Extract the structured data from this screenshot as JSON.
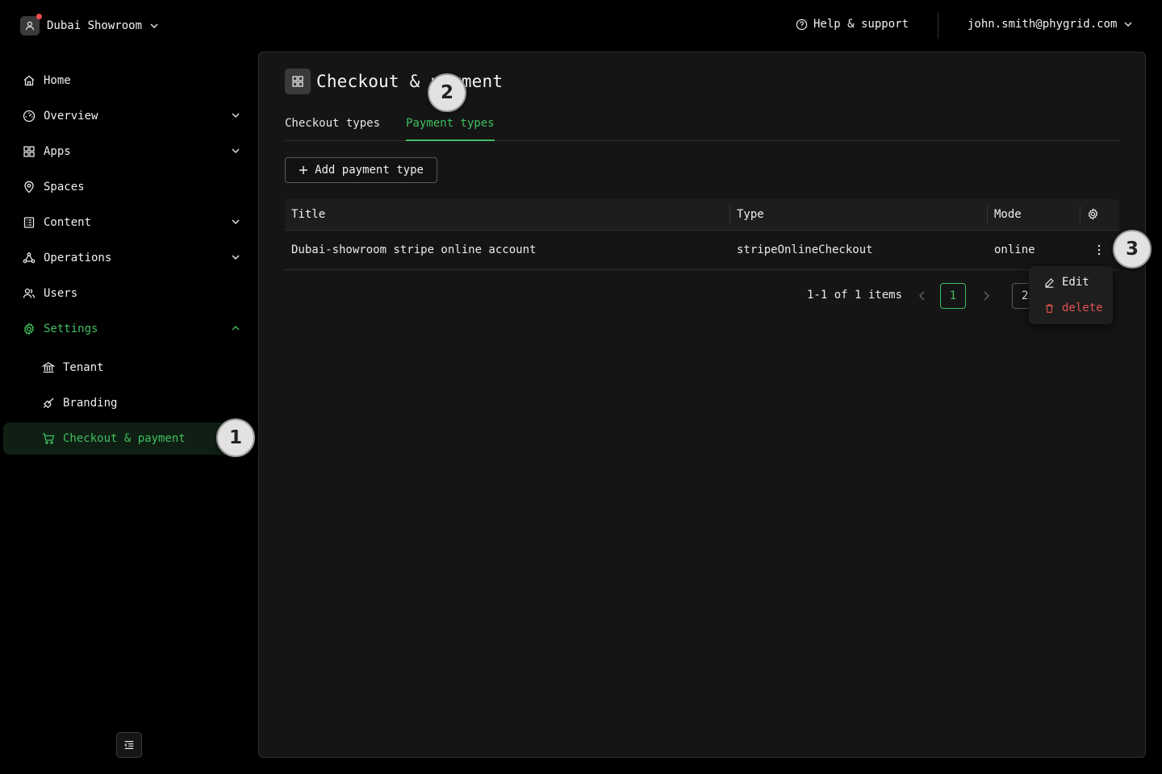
{
  "header": {
    "tenant": "Dubai Showroom",
    "help_label": "Help & support",
    "user_email": "john.smith@phygrid.com"
  },
  "sidebar": {
    "items": [
      {
        "label": "Home",
        "icon": "home-icon"
      },
      {
        "label": "Overview",
        "icon": "dashboard-icon"
      },
      {
        "label": "Apps",
        "icon": "apps-grid-icon"
      },
      {
        "label": "Spaces",
        "icon": "location-pin-icon"
      },
      {
        "label": "Content",
        "icon": "content-list-icon"
      },
      {
        "label": "Operations",
        "icon": "network-icon"
      },
      {
        "label": "Users",
        "icon": "users-icon"
      },
      {
        "label": "Settings",
        "icon": "gear-icon"
      }
    ],
    "settings_sub": [
      {
        "label": "Tenant",
        "icon": "bank-icon"
      },
      {
        "label": "Branding",
        "icon": "brush-icon"
      },
      {
        "label": "Checkout & payment",
        "icon": "cart-icon"
      }
    ]
  },
  "page": {
    "title": "Checkout & payment",
    "tabs": [
      {
        "label": "Checkout types"
      },
      {
        "label": "Payment types"
      }
    ],
    "add_button": "Add payment type"
  },
  "table": {
    "columns": [
      "Title",
      "Type",
      "Mode"
    ],
    "rows": [
      {
        "title": "Dubai-showroom stripe online account",
        "type": "stripeOnlineCheckout",
        "mode": "online"
      }
    ]
  },
  "pagination": {
    "info": "1-1 of 1 items",
    "current_page": "1",
    "page_size": "2"
  },
  "row_menu": {
    "edit": "Edit",
    "delete": "delete"
  },
  "badges": [
    "1",
    "2",
    "3"
  ],
  "colors": {
    "accent": "#3fbf5f",
    "danger": "#e0534f",
    "background": "#000000",
    "panel": "#151515"
  }
}
